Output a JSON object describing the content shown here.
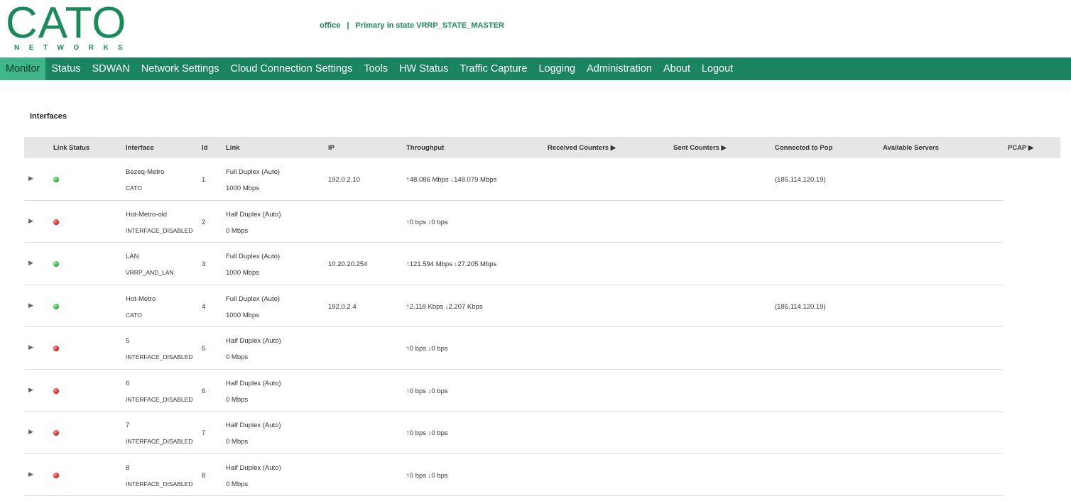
{
  "header": {
    "logo_word": "CATO",
    "logo_sub": "NETWORKS",
    "site_name": "office",
    "separator": "|",
    "state_text": "Primary in state VRRP_STATE_MASTER"
  },
  "nav": [
    {
      "label": "Monitor"
    },
    {
      "label": "Status"
    },
    {
      "label": "SDWAN"
    },
    {
      "label": "Network Settings"
    },
    {
      "label": "Cloud Connection Settings"
    },
    {
      "label": "Tools"
    },
    {
      "label": "HW Status"
    },
    {
      "label": "Traffic Capture"
    },
    {
      "label": "Logging"
    },
    {
      "label": "Administration"
    },
    {
      "label": "About"
    },
    {
      "label": "Logout"
    }
  ],
  "section_title": "Interfaces",
  "columns": {
    "link_status": "Link Status",
    "interface": "Interface",
    "id": "Id",
    "link": "Link",
    "ip": "IP",
    "throughput": "Throughput",
    "received": "Received Counters ▶",
    "sent": "Sent Counters ▶",
    "pop": "Connected to Pop",
    "servers": "Available Servers",
    "pcap": "PCAP ▶"
  },
  "rows": [
    {
      "status": "green",
      "name": "Bezeq-Metro",
      "role": "CATO",
      "id": "1",
      "duplex": "Full Duplex (Auto)",
      "speed": "1000 Mbps",
      "ip": "192.0.2.10",
      "throughput": "↑48.086 Mbps ↓148.079 Mbps",
      "pop": "(185.114.120.19)"
    },
    {
      "status": "red",
      "name": "Hot-Metro-old",
      "role": "INTERFACE_DISABLED",
      "id": "2",
      "duplex": "Half Duplex (Auto)",
      "speed": "0 Mbps",
      "ip": "",
      "throughput": "↑0 bps ↓0 bps",
      "pop": ""
    },
    {
      "status": "green",
      "name": "LAN",
      "role": "VRRP_AND_LAN",
      "id": "3",
      "duplex": "Full Duplex (Auto)",
      "speed": "1000 Mbps",
      "ip": "10.20.20.254",
      "throughput": "↑121.594 Mbps ↓27.205 Mbps",
      "pop": ""
    },
    {
      "status": "green",
      "name": "Hot-Metro",
      "role": "CATO",
      "id": "4",
      "duplex": "Full Duplex (Auto)",
      "speed": "1000 Mbps",
      "ip": "192.0.2.4",
      "throughput": "↑2.118 Kbps ↓2.207 Kbps",
      "pop": "(185.114.120.19)"
    },
    {
      "status": "red",
      "name": "5",
      "role": "INTERFACE_DISABLED",
      "id": "5",
      "duplex": "Half Duplex (Auto)",
      "speed": "0 Mbps",
      "ip": "",
      "throughput": "↑0 bps ↓0 bps",
      "pop": ""
    },
    {
      "status": "red",
      "name": "6",
      "role": "INTERFACE_DISABLED",
      "id": "6",
      "duplex": "Half Duplex (Auto)",
      "speed": "0 Mbps",
      "ip": "",
      "throughput": "↑0 bps ↓0 bps",
      "pop": ""
    },
    {
      "status": "red",
      "name": "7",
      "role": "INTERFACE_DISABLED",
      "id": "7",
      "duplex": "Half Duplex (Auto)",
      "speed": "0 Mbps",
      "ip": "",
      "throughput": "↑0 bps ↓0 bps",
      "pop": ""
    },
    {
      "status": "red",
      "name": "8",
      "role": "INTERFACE_DISABLED",
      "id": "8",
      "duplex": "Half Duplex (Auto)",
      "speed": "0 Mbps",
      "ip": "",
      "throughput": "↑0 bps ↓0 bps",
      "pop": ""
    }
  ],
  "expander_glyph": "▶",
  "colors": {
    "brand": "#1b8a5a",
    "nav_bg": "#1a8360",
    "nav_active": "#3fb68a",
    "status_up": "#2fb23a",
    "status_down": "#e02020"
  }
}
